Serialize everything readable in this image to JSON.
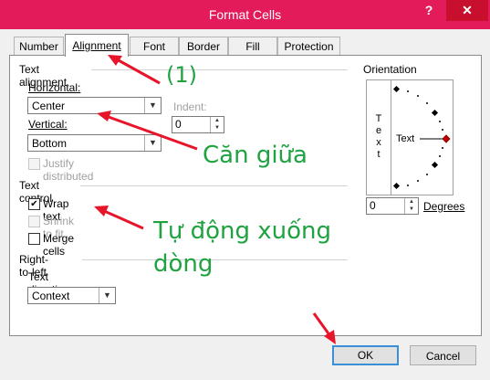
{
  "window": {
    "title": "Format Cells",
    "help": "?",
    "close": "✕"
  },
  "tabs": [
    "Number",
    "Alignment",
    "Font",
    "Border",
    "Fill",
    "Protection"
  ],
  "text_alignment": {
    "section": "Text alignment",
    "horizontal_label": "Horizontal:",
    "horizontal_value": "Center",
    "indent_label": "Indent:",
    "indent_value": "0",
    "vertical_label": "Vertical:",
    "vertical_value": "Bottom",
    "justify_label": "Justify distributed"
  },
  "text_control": {
    "section": "Text control",
    "wrap_label": "Wrap text",
    "wrap_checked": true,
    "shrink_label": "Shrink to fit",
    "merge_label": "Merge cells"
  },
  "rtl": {
    "section": "Right-to-left",
    "direction_label": "Text direction:",
    "direction_value": "Context"
  },
  "orientation": {
    "section": "Orientation",
    "vertical_text": "Text",
    "dial_text": "Text",
    "degrees_value": "0",
    "degrees_label": "Degrees"
  },
  "buttons": {
    "ok": "OK",
    "cancel": "Cancel"
  },
  "annotations": {
    "step": "(1)",
    "center": "Căn giữa",
    "wrap_line1": "Tự động xuống",
    "wrap_line2": "dòng"
  },
  "colors": {
    "titlebar": "#e31b5b",
    "close": "#c8102e",
    "annotation_text": "#1fa340",
    "arrow": "#e8152a"
  }
}
